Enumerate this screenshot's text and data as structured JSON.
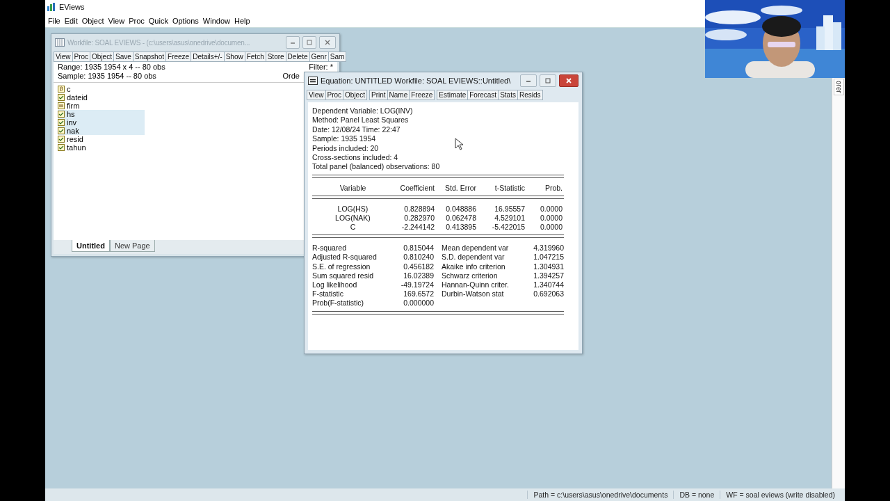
{
  "window": {
    "title": "EViews"
  },
  "menu": [
    "File",
    "Edit",
    "Object",
    "View",
    "Proc",
    "Quick",
    "Options",
    "Window",
    "Help"
  ],
  "workfile": {
    "title": "Workfile: SOAL EVIEWS - (c:\\users\\asus\\onedrive\\documen...",
    "toolbar": [
      [
        "View",
        "Proc",
        "Object"
      ],
      [
        "Save",
        "Snapshot",
        "Freeze",
        "Details+/-"
      ],
      [
        "Show",
        "Fetch",
        "Store",
        "Delete",
        "Genr",
        "Sam"
      ]
    ],
    "range": "Range:  1935 1954 x 4   --   80 obs",
    "filter": "Filter: *",
    "sample": "Sample: 1935 1954   --   80 obs",
    "order": "Orde",
    "objects": [
      {
        "name": "c",
        "kind": "coef",
        "selected": false
      },
      {
        "name": "dateid",
        "kind": "series",
        "selected": false
      },
      {
        "name": "firm",
        "kind": "alpha",
        "selected": false
      },
      {
        "name": "hs",
        "kind": "series",
        "selected": true
      },
      {
        "name": "inv",
        "kind": "series",
        "selected": true
      },
      {
        "name": "nak",
        "kind": "series",
        "selected": true
      },
      {
        "name": "resid",
        "kind": "series",
        "selected": false
      },
      {
        "name": "tahun",
        "kind": "series",
        "selected": false
      }
    ],
    "pages": [
      {
        "label": "Untitled",
        "selected": true
      },
      {
        "label": "New Page",
        "selected": false
      }
    ]
  },
  "equation": {
    "title": "Equation: UNTITLED   Workfile: SOAL EVIEWS::Untitled\\",
    "toolbar": [
      [
        "View",
        "Proc",
        "Object"
      ],
      [
        "Print",
        "Name",
        "Freeze"
      ],
      [
        "Estimate",
        "Forecast",
        "Stats",
        "Resids"
      ]
    ],
    "header": [
      "Dependent Variable: LOG(INV)",
      "Method: Panel Least Squares",
      "Date: 12/08/24   Time: 22:47",
      "Sample: 1935 1954",
      "Periods included: 20",
      "Cross-sections included: 4",
      "Total panel (balanced) observations: 80"
    ],
    "columns": [
      "Variable",
      "Coefficient",
      "Std. Error",
      "t-Statistic",
      "Prob."
    ],
    "rows": [
      [
        "LOG(HS)",
        "0.828894",
        "0.048886",
        "16.95557",
        "0.0000"
      ],
      [
        "LOG(NAK)",
        "0.282970",
        "0.062478",
        "4.529101",
        "0.0000"
      ],
      [
        "C",
        "-2.244142",
        "0.413895",
        "-5.422015",
        "0.0000"
      ]
    ],
    "stats": [
      [
        "R-squared",
        "0.815044",
        "Mean dependent var",
        "4.319960"
      ],
      [
        "Adjusted R-squared",
        "0.810240",
        "S.D. dependent var",
        "1.047215"
      ],
      [
        "S.E. of regression",
        "0.456182",
        "Akaike info criterion",
        "1.304931"
      ],
      [
        "Sum squared resid",
        "16.02389",
        "Schwarz criterion",
        "1.394257"
      ],
      [
        "Log likelihood",
        "-49.19724",
        "Hannan-Quinn criter.",
        "1.340744"
      ],
      [
        "F-statistic",
        "169.6572",
        "Durbin-Watson stat",
        "0.692063"
      ],
      [
        "Prob(F-statistic)",
        "0.000000"
      ]
    ]
  },
  "side_tab": "orer",
  "webcam": {
    "kind": "picture"
  },
  "status_bar": [
    "Path = c:\\users\\asus\\onedrive\\documents",
    "DB = none",
    "WF = soal eviews (write disabled)"
  ]
}
